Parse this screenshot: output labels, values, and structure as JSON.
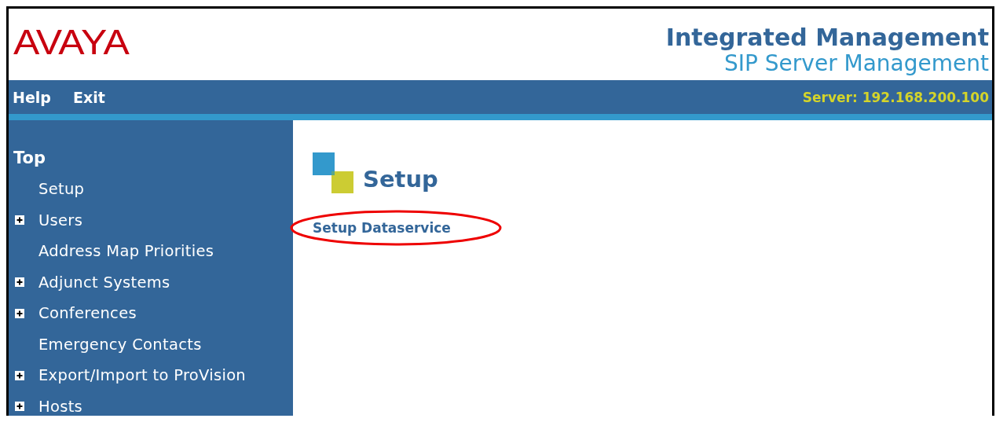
{
  "header": {
    "logo": "AVAYA",
    "title": "Integrated Management",
    "subtitle": "SIP Server Management"
  },
  "menu": [
    {
      "label": "Help"
    },
    {
      "label": "Exit"
    }
  ],
  "server": "Server: 192.168.200.100",
  "sidebar": {
    "heading": "Top",
    "items": [
      {
        "label": "Setup",
        "kind": "page"
      },
      {
        "label": "Users",
        "kind": "folder"
      },
      {
        "label": "Address Map Priorities",
        "kind": "page"
      },
      {
        "label": "Adjunct Systems",
        "kind": "folder"
      },
      {
        "label": "Conferences",
        "kind": "folder"
      },
      {
        "label": "Emergency Contacts",
        "kind": "page"
      },
      {
        "label": "Export/Import to ProVision",
        "kind": "folder"
      },
      {
        "label": "Hosts",
        "kind": "folder"
      }
    ]
  },
  "content": {
    "heading": "Setup",
    "links": [
      {
        "label": "Setup Dataservice",
        "highlighted": true
      }
    ]
  }
}
